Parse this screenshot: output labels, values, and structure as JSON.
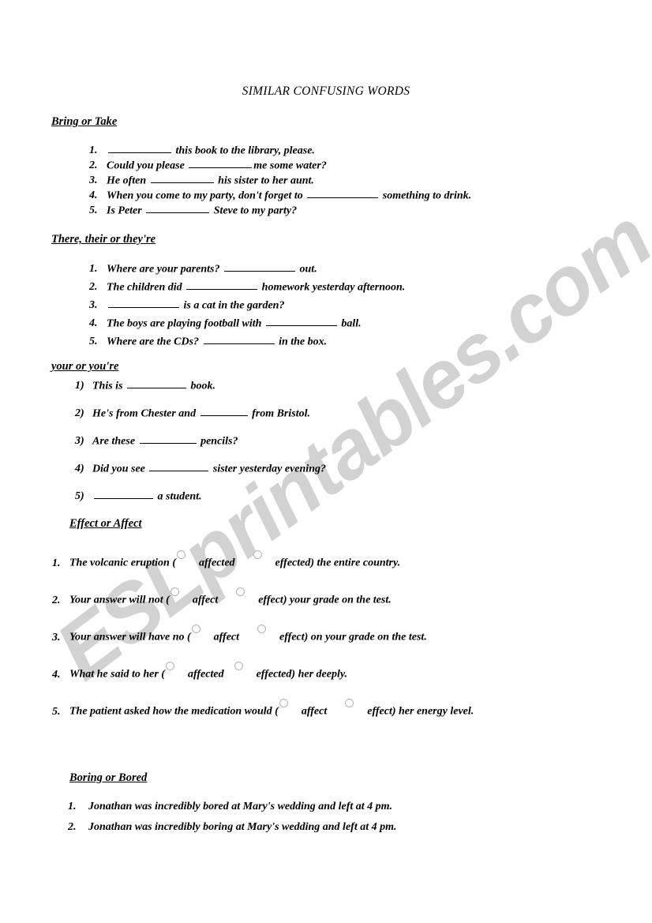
{
  "document": {
    "title": "SIMILAR CONFUSING WORDS",
    "watermark": "ESLprintables.com",
    "watermark_color": "#d2d2d2"
  },
  "sections": [
    {
      "heading": "Bring or Take",
      "items": [
        {
          "number": "1.",
          "pre": "",
          "post": " this book to the library, please."
        },
        {
          "number": "2.",
          "pre": "Could you please ",
          "post": "me some water?"
        },
        {
          "number": "3.",
          "pre": "He often ",
          "post": " his sister to her aunt."
        },
        {
          "number": "4.",
          "pre": "When you come to my party, don't forget to ",
          "post": " something to drink."
        },
        {
          "number": "5.",
          "pre": "Is Peter ",
          "post": " Steve to my party?"
        }
      ]
    },
    {
      "heading": "There, their or they're",
      "items": [
        {
          "number": "1.",
          "pre": "Where are your parents? ",
          "post": " out."
        },
        {
          "number": "2.",
          "pre": "The children did ",
          "post": " homework yesterday afternoon."
        },
        {
          "number": "3.",
          "pre": "",
          "post": " is a cat in the garden?"
        },
        {
          "number": "4.",
          "pre": "The boys are playing football with ",
          "post": " ball."
        },
        {
          "number": "5.",
          "pre": "Where are the CDs? ",
          "post": " in the box."
        }
      ]
    },
    {
      "heading": "your or you're",
      "items": [
        {
          "number": "1)",
          "pre": "This is ",
          "post": " book."
        },
        {
          "number": "2)",
          "pre": "He's from Chester and ",
          "post": " from Bristol."
        },
        {
          "number": "3)",
          "pre": "Are these ",
          "post": " pencils?"
        },
        {
          "number": "4)",
          "pre": "Did you see ",
          "post": " sister yesterday evening?"
        },
        {
          "number": "5)",
          "pre": "",
          "post": " a student."
        }
      ]
    },
    {
      "heading": "Effect or Affect",
      "items": [
        {
          "number": "1.",
          "pre": "The  volcanic eruption (",
          "option_a": "affected",
          "option_b": "effected",
          "post": ") the entire country."
        },
        {
          "number": "2.",
          "pre": "Your answer will not (",
          "option_a": "affect",
          "option_b": "effect",
          "post": ") your grade on the test."
        },
        {
          "number": "3.",
          "pre": "Your answer will have no (",
          "option_a": "affect",
          "option_b": "effect",
          "post": ") on your grade on the test."
        },
        {
          "number": "4.",
          "pre": "What he said to her (",
          "option_a": "affected",
          "option_b": "effected",
          "post": ") her deeply."
        },
        {
          "number": "5.",
          "pre": "The patient asked how the medication would (",
          "option_a": "affect",
          "option_b": "effect",
          "post": ") her energy level."
        }
      ]
    },
    {
      "heading": "Boring or Bored",
      "items": [
        {
          "number": "1.",
          "pre": "Jonathan was incredibly bored at Mary's wedding and left at 4 pm.",
          "post": ""
        },
        {
          "number": "2.",
          "pre": "Jonathan was incredibly boring at Mary's wedding and left at 4 pm.",
          "post": ""
        }
      ]
    }
  ]
}
